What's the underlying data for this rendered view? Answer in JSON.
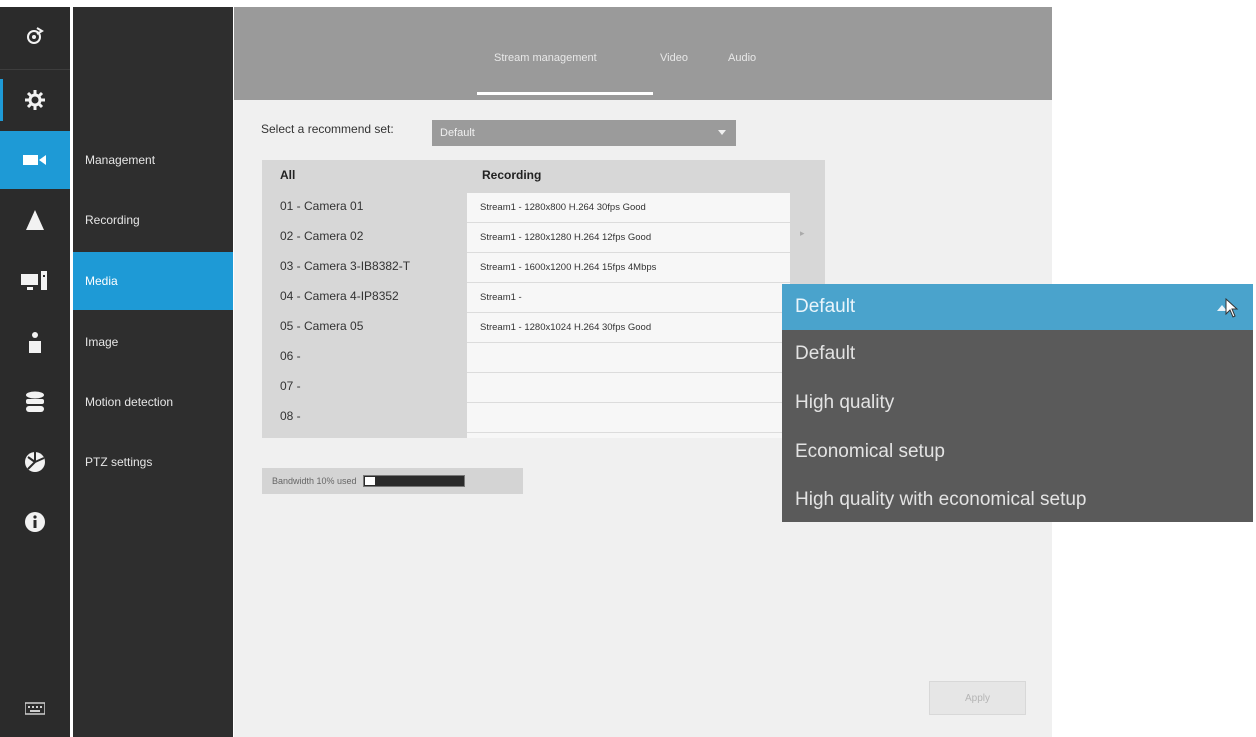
{
  "tabs": [
    {
      "label": "Stream management"
    },
    {
      "label": "Video"
    },
    {
      "label": "Audio"
    }
  ],
  "rail_icons": [
    "logout-icon",
    "settings-gear-icon",
    "camera-icon",
    "alert-icon",
    "display-icon",
    "user-icon",
    "storage-icon",
    "network-icon",
    "info-icon",
    "keyboard-icon"
  ],
  "menu": {
    "items": [
      {
        "label": "Management"
      },
      {
        "label": "Recording"
      },
      {
        "label": "Media"
      },
      {
        "label": "Image"
      },
      {
        "label": "Motion detection"
      },
      {
        "label": "PTZ settings"
      }
    ],
    "active": "Media"
  },
  "recommend": {
    "label": "Select a recommend set:",
    "value": "Default"
  },
  "table": {
    "headers": {
      "col1": "All",
      "col2": "Recording"
    },
    "rows": [
      {
        "camera": "01 - Camera 01",
        "recording": "Stream1 - 1280x800 H.264 30fps Good"
      },
      {
        "camera": "02 - Camera 02",
        "recording": "Stream1 - 1280x1280 H.264 12fps Good"
      },
      {
        "camera": "03 - Camera 3-IB8382-T",
        "recording": "Stream1 - 1600x1200 H.264 15fps 4Mbps"
      },
      {
        "camera": "04 - Camera 4-IP8352",
        "recording": "Stream1 -"
      },
      {
        "camera": "05 - Camera 05",
        "recording": "Stream1 - 1280x1024 H.264 30fps Good"
      },
      {
        "camera": "06 -",
        "recording": ""
      },
      {
        "camera": "07 -",
        "recording": ""
      },
      {
        "camera": "08 -",
        "recording": ""
      }
    ]
  },
  "bandwidth": {
    "label": "Bandwidth 10% used",
    "fraction": 0.1
  },
  "apply_label": "Apply",
  "popup": {
    "selected": "Default",
    "options": [
      "Default",
      "High quality",
      "Economical setup",
      "High quality with economical setup"
    ]
  },
  "colors": {
    "accent": "#1e9ad6",
    "popup_selected": "#4aa3cc",
    "sidebar": "#2b2b2b",
    "topbar": "#9a9a9a"
  }
}
